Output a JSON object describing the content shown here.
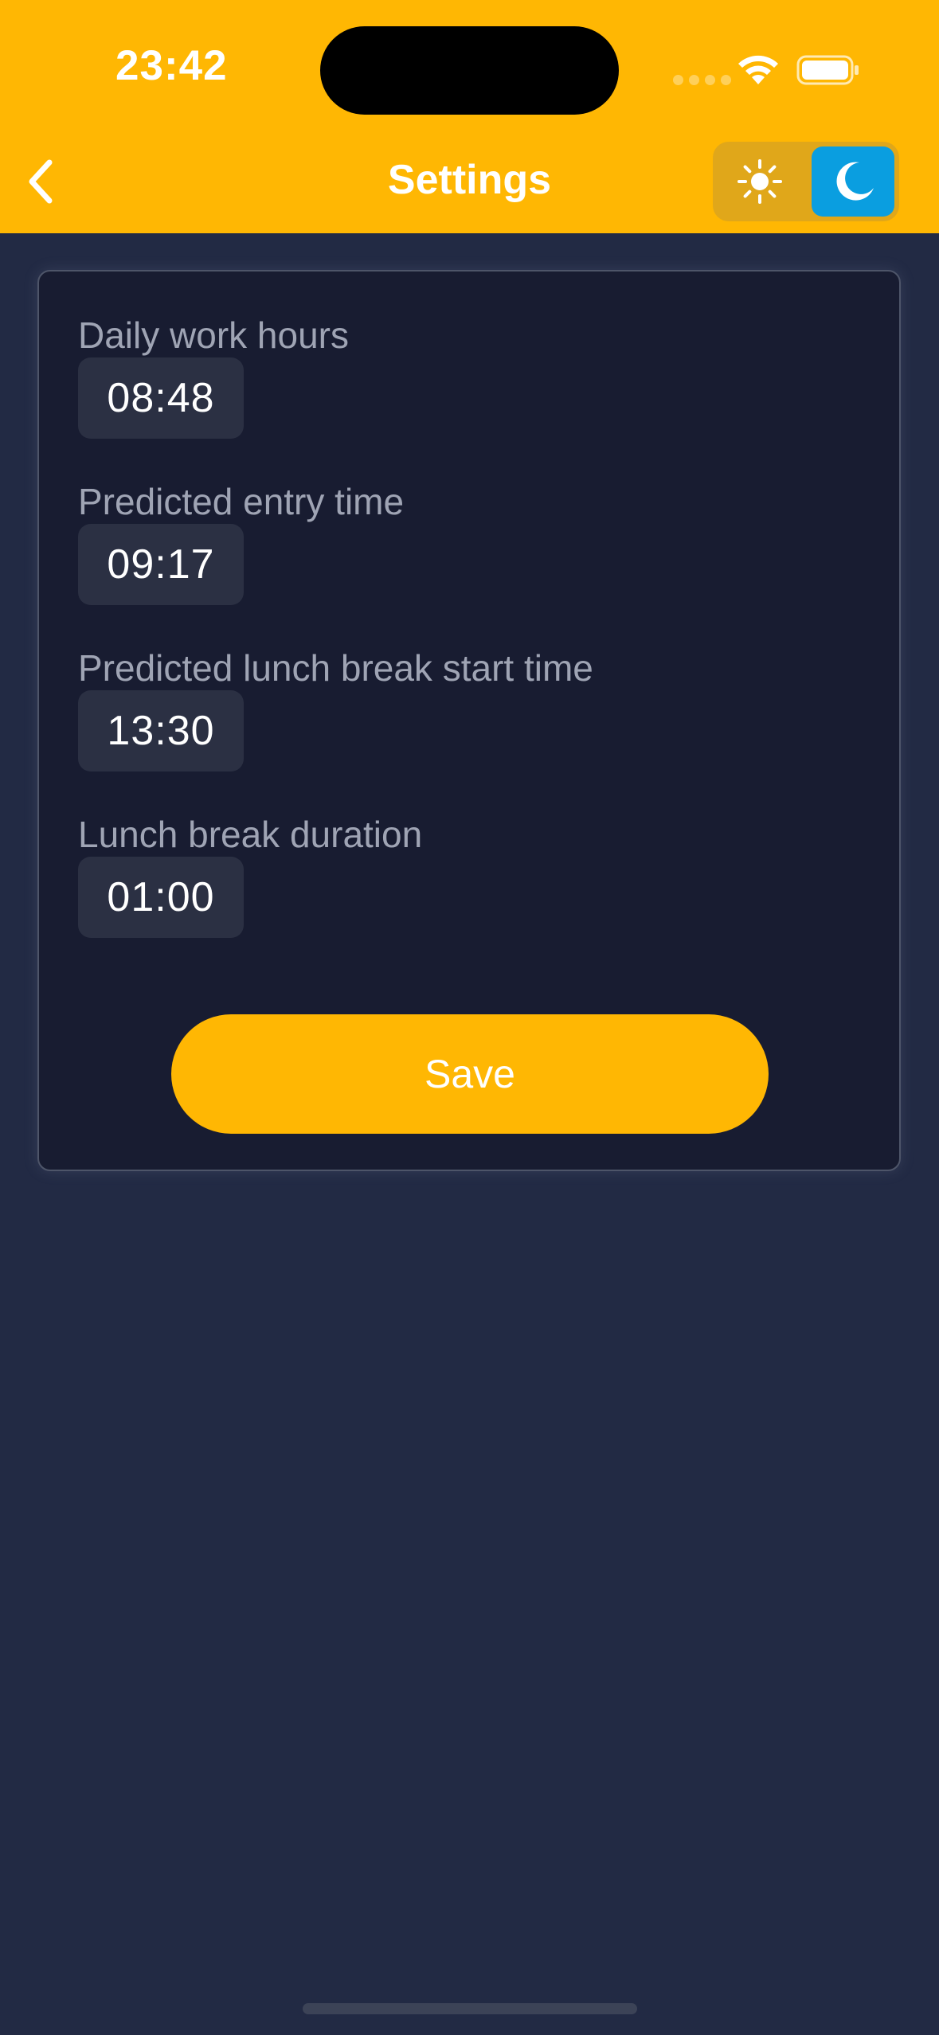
{
  "status_bar": {
    "time": "23:42"
  },
  "header": {
    "title": "Settings",
    "back_icon": "chevron-left-icon",
    "theme_light_icon": "sun-icon",
    "theme_dark_icon": "moon-icon",
    "active_theme": "dark"
  },
  "settings": {
    "fields": [
      {
        "label": "Daily work hours",
        "value": "08:48"
      },
      {
        "label": "Predicted entry time",
        "value": "09:17"
      },
      {
        "label": "Predicted lunch break start time",
        "value": "13:30"
      },
      {
        "label": "Lunch break duration",
        "value": "01:00"
      }
    ],
    "save_label": "Save"
  },
  "colors": {
    "accent": "#ffb703",
    "background": "#222a44",
    "card": "#181c31",
    "input": "#2b3043",
    "toggle_active": "#0a9ee0"
  }
}
